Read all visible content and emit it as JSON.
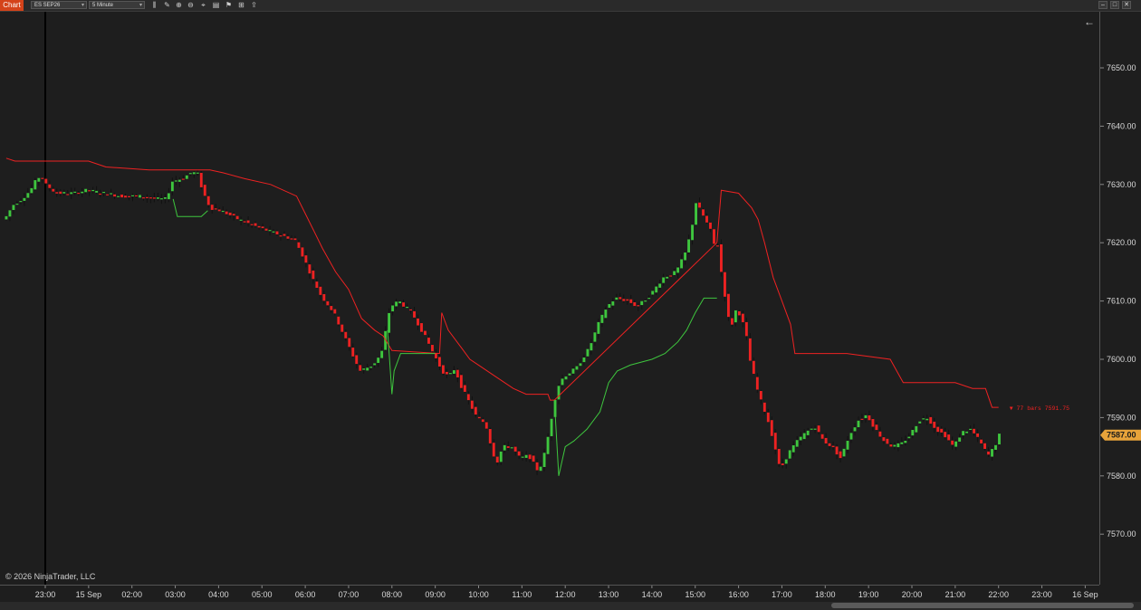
{
  "toolbar": {
    "tab_label": "Chart",
    "instrument": "ES SEP26",
    "interval": "5 Minute",
    "icons": [
      "bar-type-icon",
      "draw-icon",
      "zoom-in-icon",
      "zoom-out-icon",
      "cursor-icon",
      "properties-icon",
      "strategy-icon",
      "templates-icon",
      "share-icon"
    ]
  },
  "footer": {
    "copyright": "© 2026 NinjaTrader, LLC"
  },
  "axis_corner": "F",
  "chart_data": {
    "type": "candlestick",
    "instrument": "ES SEP26",
    "interval": "5 Minute",
    "price_ticks": [
      7650,
      7640,
      7630,
      7620,
      7610,
      7600,
      7590,
      7580,
      7570
    ],
    "price_tick_labels": [
      "7650.00",
      "7640.00",
      "7630.00",
      "7620.00",
      "7610.00",
      "7600.00",
      "7590.00",
      "7580.00",
      "7570.00"
    ],
    "current_price": "7587.00",
    "time_ticks": [
      {
        "t": 0,
        "label": "23:00"
      },
      {
        "t": 1,
        "label": "15 Sep"
      },
      {
        "t": 2,
        "label": "02:00"
      },
      {
        "t": 3,
        "label": "03:00"
      },
      {
        "t": 4,
        "label": "04:00"
      },
      {
        "t": 5,
        "label": "05:00"
      },
      {
        "t": 6,
        "label": "06:00"
      },
      {
        "t": 7,
        "label": "07:00"
      },
      {
        "t": 8,
        "label": "08:00"
      },
      {
        "t": 9,
        "label": "09:00"
      },
      {
        "t": 10,
        "label": "10:00"
      },
      {
        "t": 11,
        "label": "11:00"
      },
      {
        "t": 12,
        "label": "12:00"
      },
      {
        "t": 13,
        "label": "13:00"
      },
      {
        "t": 14,
        "label": "14:00"
      },
      {
        "t": 15,
        "label": "15:00"
      },
      {
        "t": 16,
        "label": "16:00"
      },
      {
        "t": 17,
        "label": "17:00"
      },
      {
        "t": 18,
        "label": "18:00"
      },
      {
        "t": 19,
        "label": "19:00"
      },
      {
        "t": 20,
        "label": "20:00"
      },
      {
        "t": 21,
        "label": "21:00"
      },
      {
        "t": 22,
        "label": "22:00"
      },
      {
        "t": 23,
        "label": "23:00"
      },
      {
        "t": 24,
        "label": "16 Sep"
      }
    ],
    "annotation": "▼ 77 bars  7591.75",
    "colors": {
      "up": "#3ec63e",
      "down": "#ee2222",
      "stop_down": "#ee2222",
      "stop_up": "#3ec63e"
    },
    "price_path": [
      [
        -0.9,
        7624
      ],
      [
        -0.7,
        7626.5
      ],
      [
        -0.5,
        7627.5
      ],
      [
        -0.3,
        7629
      ],
      [
        -0.15,
        7631
      ],
      [
        -0.05,
        7631.5
      ],
      [
        0.05,
        7630
      ],
      [
        0.3,
        7628.5
      ],
      [
        0.7,
        7628.5
      ],
      [
        1.0,
        7629
      ],
      [
        1.4,
        7628.5
      ],
      [
        1.8,
        7628
      ],
      [
        2.2,
        7628
      ],
      [
        2.6,
        7627.5
      ],
      [
        2.85,
        7627.5
      ],
      [
        2.95,
        7630.5
      ],
      [
        3.2,
        7631
      ],
      [
        3.4,
        7632
      ],
      [
        3.55,
        7632
      ],
      [
        3.65,
        7629.5
      ],
      [
        3.75,
        7627.5
      ],
      [
        3.85,
        7626
      ],
      [
        4.1,
        7625.5
      ],
      [
        4.5,
        7624
      ],
      [
        5.0,
        7622.5
      ],
      [
        5.4,
        7621.5
      ],
      [
        5.8,
        7620.5
      ],
      [
        6.0,
        7617.5
      ],
      [
        6.2,
        7614
      ],
      [
        6.4,
        7611
      ],
      [
        6.7,
        7608
      ],
      [
        7.0,
        7603
      ],
      [
        7.3,
        7598
      ],
      [
        7.6,
        7599
      ],
      [
        7.8,
        7601
      ],
      [
        7.9,
        7605
      ],
      [
        8.0,
        7609
      ],
      [
        8.2,
        7610
      ],
      [
        8.5,
        7608
      ],
      [
        8.8,
        7604
      ],
      [
        9.0,
        7601
      ],
      [
        9.2,
        7598
      ],
      [
        9.35,
        7597
      ],
      [
        9.5,
        7598.5
      ],
      [
        9.6,
        7596
      ],
      [
        9.8,
        7593
      ],
      [
        10.0,
        7590
      ],
      [
        10.2,
        7589
      ],
      [
        10.3,
        7586
      ],
      [
        10.45,
        7582
      ],
      [
        10.6,
        7585
      ],
      [
        10.8,
        7585
      ],
      [
        11.0,
        7583
      ],
      [
        11.2,
        7583.5
      ],
      [
        11.4,
        7581
      ],
      [
        11.5,
        7582
      ],
      [
        11.6,
        7585
      ],
      [
        11.7,
        7589
      ],
      [
        11.85,
        7595
      ],
      [
        12.0,
        7597
      ],
      [
        12.3,
        7598.5
      ],
      [
        12.6,
        7602
      ],
      [
        12.8,
        7606
      ],
      [
        13.0,
        7609
      ],
      [
        13.2,
        7610.5
      ],
      [
        13.5,
        7610
      ],
      [
        13.7,
        7609
      ],
      [
        14.0,
        7611
      ],
      [
        14.3,
        7614
      ],
      [
        14.6,
        7615
      ],
      [
        14.8,
        7618
      ],
      [
        14.95,
        7622
      ],
      [
        15.05,
        7627
      ],
      [
        15.2,
        7625
      ],
      [
        15.4,
        7622
      ],
      [
        15.5,
        7619
      ],
      [
        15.6,
        7620
      ],
      [
        15.65,
        7614
      ],
      [
        15.75,
        7610
      ],
      [
        15.85,
        7605
      ],
      [
        16.0,
        7609
      ],
      [
        16.2,
        7605
      ],
      [
        16.3,
        7600
      ],
      [
        16.5,
        7594
      ],
      [
        16.7,
        7590
      ],
      [
        16.85,
        7586
      ],
      [
        17.0,
        7581
      ],
      [
        17.2,
        7584
      ],
      [
        17.4,
        7586
      ],
      [
        17.6,
        7587.5
      ],
      [
        17.8,
        7588.5
      ],
      [
        18.0,
        7586
      ],
      [
        18.2,
        7585
      ],
      [
        18.4,
        7583
      ],
      [
        18.6,
        7587
      ],
      [
        18.8,
        7589.5
      ],
      [
        19.0,
        7590.5
      ],
      [
        19.2,
        7588
      ],
      [
        19.4,
        7586
      ],
      [
        19.6,
        7585
      ],
      [
        19.8,
        7585.5
      ],
      [
        20.0,
        7587
      ],
      [
        20.2,
        7589.5
      ],
      [
        20.4,
        7590
      ],
      [
        20.6,
        7588
      ],
      [
        20.8,
        7587
      ],
      [
        21.0,
        7585
      ],
      [
        21.2,
        7587.5
      ],
      [
        21.4,
        7588
      ],
      [
        21.6,
        7586
      ],
      [
        21.8,
        7583.5
      ],
      [
        21.95,
        7585
      ],
      [
        22.05,
        7587
      ]
    ],
    "stop_upper_line": [
      [
        -0.9,
        7634.5
      ],
      [
        -0.7,
        7634
      ],
      [
        1.0,
        7634
      ],
      [
        1.4,
        7633
      ],
      [
        2.4,
        7632.5
      ],
      [
        2.95,
        7632.5
      ],
      [
        3.8,
        7632.5
      ],
      [
        4.1,
        7632
      ],
      [
        4.6,
        7631
      ],
      [
        5.2,
        7630
      ],
      [
        5.8,
        7628
      ],
      [
        6.0,
        7625
      ],
      [
        6.2,
        7622
      ],
      [
        6.4,
        7619
      ],
      [
        6.7,
        7615
      ],
      [
        7.0,
        7612
      ],
      [
        7.3,
        7607
      ],
      [
        7.6,
        7605
      ],
      [
        7.8,
        7604
      ],
      [
        8.0,
        7601.5
      ],
      [
        9.1,
        7601
      ],
      [
        9.15,
        7608
      ],
      [
        9.3,
        7605
      ],
      [
        9.6,
        7602
      ],
      [
        9.8,
        7600
      ],
      [
        10.0,
        7599
      ],
      [
        10.4,
        7597
      ],
      [
        10.8,
        7595
      ],
      [
        11.1,
        7594
      ],
      [
        11.6,
        7594
      ],
      [
        11.65,
        7593
      ],
      [
        11.75,
        7593
      ],
      [
        15.5,
        7620
      ],
      [
        15.6,
        7629
      ],
      [
        16.0,
        7628.5
      ],
      [
        16.3,
        7626
      ],
      [
        16.45,
        7624
      ],
      [
        16.6,
        7620
      ],
      [
        16.8,
        7614
      ],
      [
        17.0,
        7610
      ],
      [
        17.2,
        7606
      ],
      [
        17.3,
        7601
      ],
      [
        18.5,
        7601
      ],
      [
        19.5,
        7600
      ],
      [
        19.8,
        7596
      ],
      [
        20.5,
        7596
      ],
      [
        21.0,
        7596
      ],
      [
        21.4,
        7595
      ],
      [
        21.7,
        7595
      ],
      [
        21.85,
        7591.75
      ],
      [
        22.0,
        7591.75
      ]
    ],
    "stop_lower_green_1": [
      [
        2.95,
        7627.5
      ],
      [
        3.05,
        7624.5
      ],
      [
        3.6,
        7624.5
      ],
      [
        3.75,
        7625.5
      ]
    ],
    "stop_lower_green_2": [
      [
        7.9,
        7605
      ],
      [
        8.0,
        7594
      ],
      [
        8.05,
        7598
      ],
      [
        8.2,
        7601
      ],
      [
        9.0,
        7601
      ]
    ],
    "stop_lower_green_3": [
      [
        11.75,
        7593
      ],
      [
        11.85,
        7580
      ],
      [
        12.0,
        7585
      ],
      [
        12.2,
        7586
      ],
      [
        12.5,
        7588
      ],
      [
        12.8,
        7591
      ],
      [
        13.0,
        7596
      ],
      [
        13.2,
        7598
      ],
      [
        13.5,
        7599
      ],
      [
        14.0,
        7600
      ],
      [
        14.3,
        7601
      ],
      [
        14.6,
        7603
      ],
      [
        14.8,
        7605
      ],
      [
        15.0,
        7608
      ],
      [
        15.2,
        7610.5
      ],
      [
        15.5,
        7610.5
      ]
    ]
  }
}
